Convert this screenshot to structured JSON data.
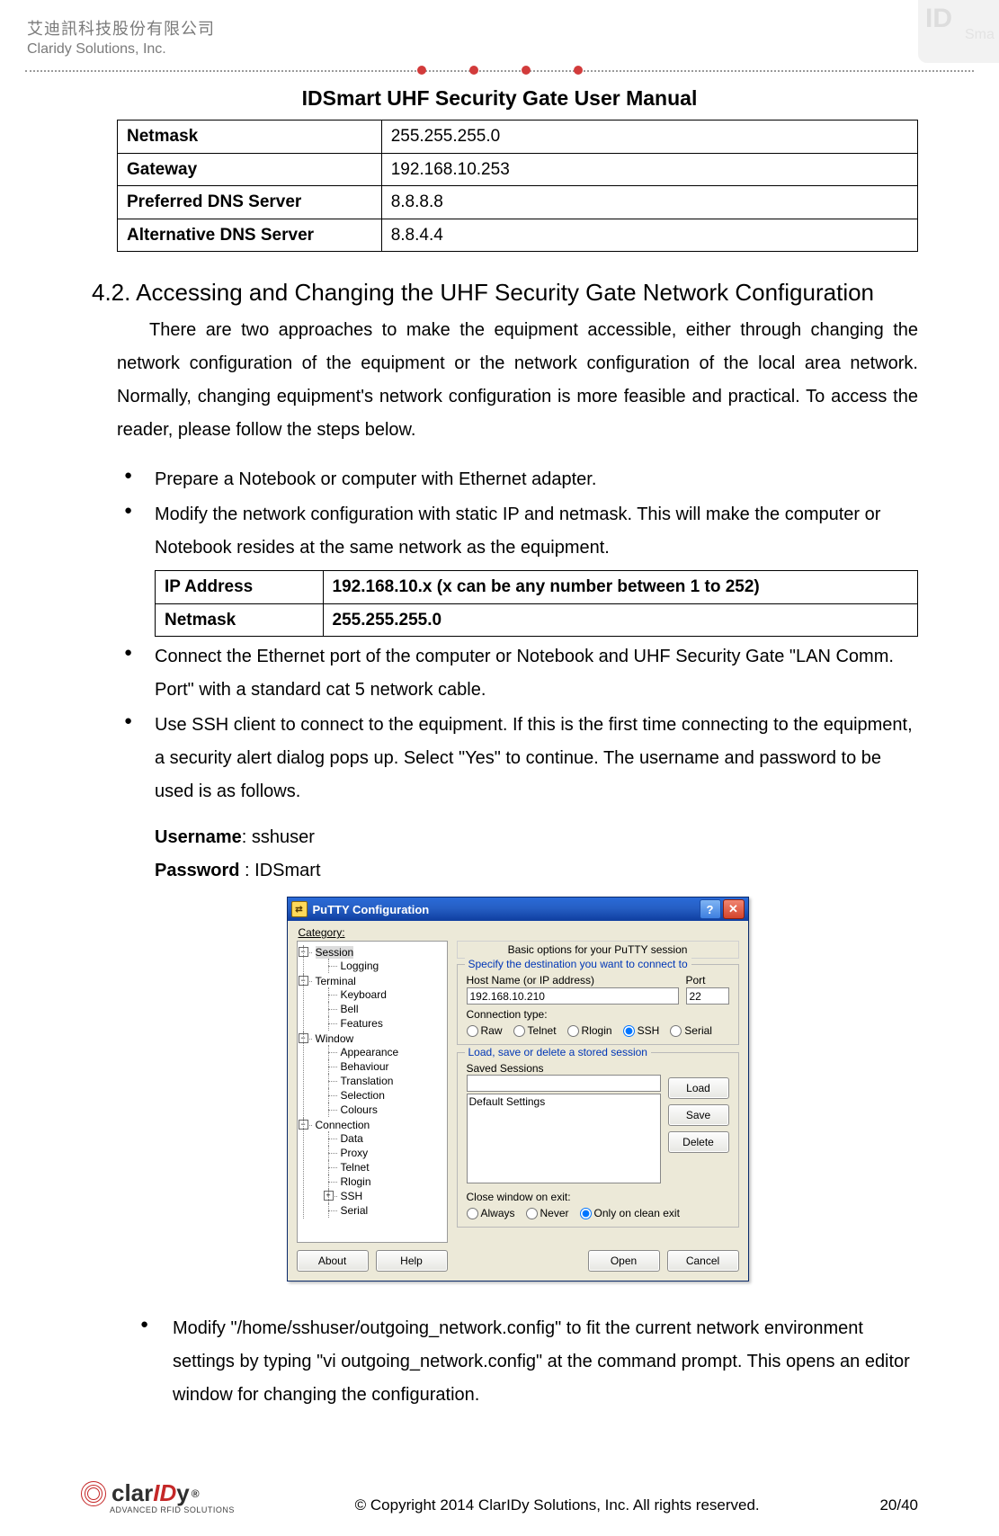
{
  "header": {
    "company_ch": "艾迪訊科技股份有限公司",
    "company_en": "Claridy Solutions, Inc.",
    "watermark_big": "ID",
    "watermark_small": "Sma"
  },
  "doc_title": "IDSmart UHF Security Gate User Manual",
  "table1": {
    "rows": [
      {
        "label": "Netmask",
        "value": "255.255.255.0"
      },
      {
        "label": "Gateway",
        "value": "192.168.10.253"
      },
      {
        "label": "Preferred DNS Server",
        "value": "8.8.8.8"
      },
      {
        "label": "Alternative DNS Server",
        "value": "8.8.4.4"
      }
    ]
  },
  "section_heading": "4.2. Accessing and Changing the UHF Security Gate Network Configuration",
  "intro_para": "There are two approaches to make the equipment accessible, either through changing the network configuration of the equipment or the network configuration of the local area network. Normally, changing equipment's network configuration is more feasible and practical. To access the reader, please follow the steps below.",
  "bul1": "Prepare a Notebook or computer with Ethernet adapter.",
  "bul2": "Modify the network configuration with static IP and netmask. This will make the computer or Notebook resides at the same network as the equipment.",
  "table2": {
    "rows": [
      {
        "label": "IP Address",
        "value": "192.168.10.x (x can be any number between 1 to 252)"
      },
      {
        "label": "Netmask",
        "value": "255.255.255.0"
      }
    ]
  },
  "bul3": "Connect the Ethernet port of the computer or Notebook and UHF Security Gate \"LAN Comm. Port\" with a standard cat 5 network cable.",
  "bul4": "Use SSH client to connect to the equipment. If this is the first time connecting to the equipment, a security alert dialog pops up. Select \"Yes\" to continue. The username and password to be used is as follows.",
  "cred_user_label": "Username",
  "cred_user_value": ": sshuser",
  "cred_pass_label": "Password",
  "cred_pass_value": " : IDSmart",
  "putty": {
    "title": "PuTTY Configuration",
    "category_label": "Category:",
    "tree": {
      "session": "Session",
      "logging": "Logging",
      "terminal": "Terminal",
      "keyboard": "Keyboard",
      "bell": "Bell",
      "features": "Features",
      "window": "Window",
      "appearance": "Appearance",
      "behaviour": "Behaviour",
      "translation": "Translation",
      "selection": "Selection",
      "colours": "Colours",
      "connection": "Connection",
      "data": "Data",
      "proxy": "Proxy",
      "telnet": "Telnet",
      "rlogin": "Rlogin",
      "ssh": "SSH",
      "serial": "Serial"
    },
    "banner": "Basic options for your PuTTY session",
    "group1_legend": "Specify the destination you want to connect to",
    "host_label": "Host Name (or IP address)",
    "host_value": "192.168.10.210",
    "port_label": "Port",
    "port_value": "22",
    "conn_type_label": "Connection type:",
    "radios": {
      "raw": "Raw",
      "telnet": "Telnet",
      "rlogin": "Rlogin",
      "ssh": "SSH",
      "serial": "Serial"
    },
    "group2_legend": "Load, save or delete a stored session",
    "saved_label": "Saved Sessions",
    "default_settings": "Default Settings",
    "btn_load": "Load",
    "btn_save": "Save",
    "btn_delete": "Delete",
    "close_label": "Close window on exit:",
    "close_opts": {
      "always": "Always",
      "never": "Never",
      "clean": "Only on clean exit"
    },
    "btn_about": "About",
    "btn_help": "Help",
    "btn_open": "Open",
    "btn_cancel": "Cancel"
  },
  "bul5": "Modify \"/home/sshuser/outgoing_network.config\" to fit the current network environment settings by typing \"vi outgoing_network.config\" at the command prompt. This opens an editor window for changing the configuration.",
  "footer": {
    "brand1": "clar",
    "brand2": "ID",
    "brand3": "y",
    "reg": "®",
    "tagline": "ADVANCED RFID SOLUTIONS",
    "copyright": "© Copyright 2014 ClarIDy Solutions, Inc. All rights reserved.",
    "page": "20/40"
  }
}
